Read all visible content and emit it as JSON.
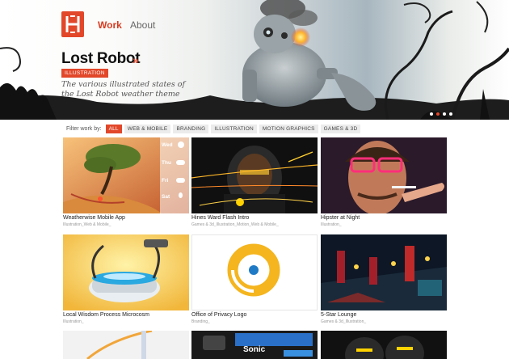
{
  "nav": {
    "work": "Work",
    "about": "About"
  },
  "hero": {
    "title": "Lost Robot",
    "badge": "ILLUSTRATION",
    "description": "The various illustrated states of the Lost Robot weather theme",
    "slides": 4,
    "active_slide": 2
  },
  "filter": {
    "label": "Filter work by:",
    "options": [
      "ALL",
      "WEB & MOBILE",
      "BRANDING",
      "ILLUSTRATION",
      "MOTION GRAPHICS",
      "GAMES & 3D"
    ],
    "active": "ALL"
  },
  "portfolio": [
    {
      "title": "Weatherwise Mobile App",
      "tags": "Illustration_Web & Mobile_",
      "overlay": [
        "Wed",
        "Thu",
        "Fri",
        "Sat"
      ]
    },
    {
      "title": "Hines Ward Flash Intro",
      "tags": "Games & 3d_Illustration_Motion_Web & Mobile_"
    },
    {
      "title": "Hipster at Night",
      "tags": "Illustration_"
    },
    {
      "title": "Local Wisdom Process Microcosm",
      "tags": "Illustration_"
    },
    {
      "title": "Office of Privacy Logo",
      "tags": "Branding_"
    },
    {
      "title": "5-Star Lounge",
      "tags": "Games & 3d_Illustration_"
    },
    {
      "title": "",
      "tags": ""
    },
    {
      "title": "",
      "tags": "",
      "overlay_word": "Sonic"
    },
    {
      "title": "",
      "tags": ""
    }
  ],
  "colors": {
    "accent": "#e2472a",
    "chip": "#ececec"
  }
}
